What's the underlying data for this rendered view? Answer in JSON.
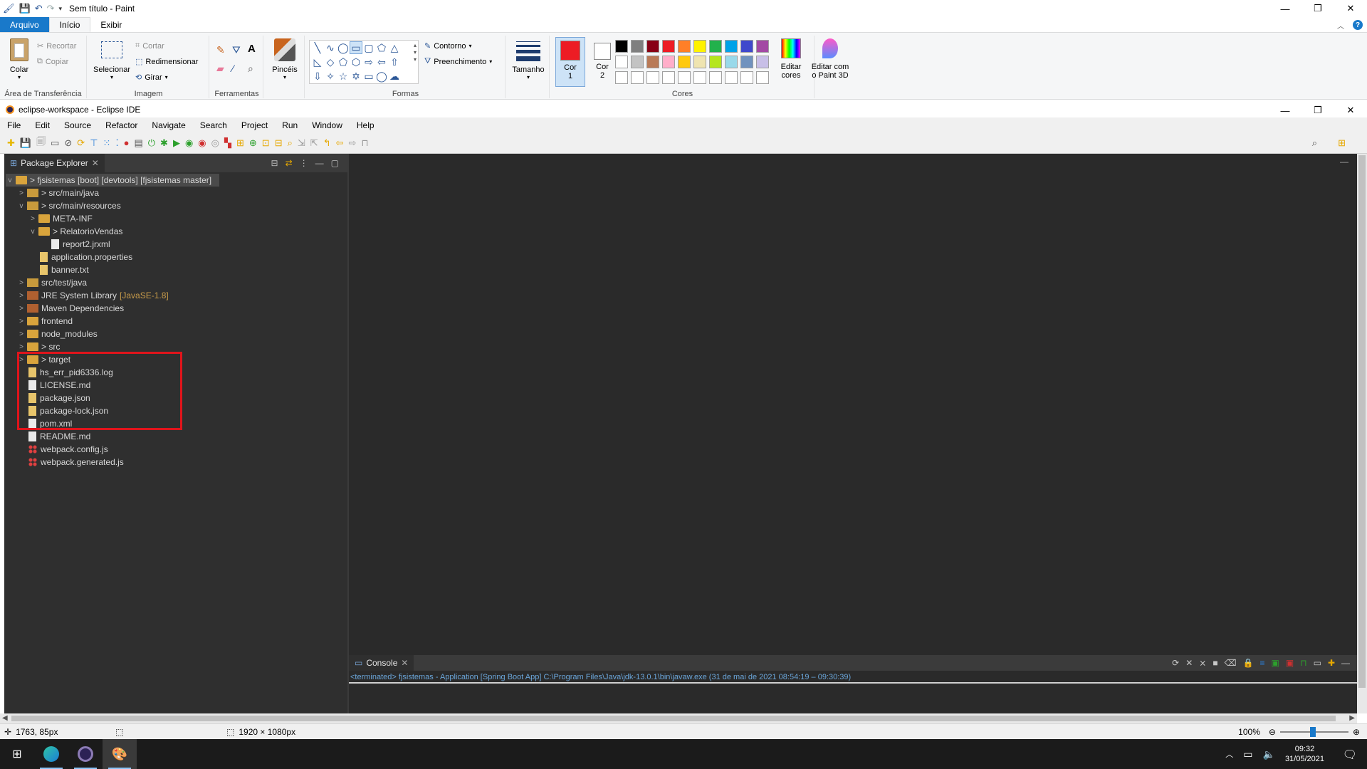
{
  "paint": {
    "title": "Sem título - Paint",
    "tabs": [
      "Arquivo",
      "Início",
      "Exibir"
    ],
    "groups": {
      "clipboard": {
        "label": "Área de Transferência",
        "paste": "Colar",
        "cut": "Recortar",
        "copy": "Copiar"
      },
      "image": {
        "label": "Imagem",
        "select": "Selecionar",
        "crop": "Cortar",
        "resize": "Redimensionar",
        "rotate": "Girar"
      },
      "tools": {
        "label": "Ferramentas"
      },
      "brushes": {
        "label": "Pincéis"
      },
      "shapes": {
        "label": "Formas",
        "outline": "Contorno",
        "fill": "Preenchimento"
      },
      "size": {
        "label": "Tamanho"
      },
      "colors": {
        "label": "Cores",
        "color1": "Cor",
        "color1_num": "1",
        "color2": "Cor",
        "color2_num": "2",
        "color1_value": "#ed1c24",
        "color2_value": "#ffffff",
        "edit": "Editar",
        "edit2": "cores",
        "palette_row1": [
          "#000000",
          "#7f7f7f",
          "#880015",
          "#ed1c24",
          "#ff7f27",
          "#fff200",
          "#22b14c",
          "#00a2e8",
          "#3f48cc",
          "#a349a4"
        ],
        "palette_row2": [
          "#ffffff",
          "#c3c3c3",
          "#b97a57",
          "#ffaec9",
          "#ffc90e",
          "#efe4b0",
          "#b5e61d",
          "#99d9ea",
          "#7092be",
          "#c8bfe7"
        ]
      },
      "paint3d": {
        "line1": "Editar com",
        "line2": "o Paint 3D"
      }
    },
    "status": {
      "cursor_pos": "1763, 85px",
      "canvas_size": "1920 × 1080px",
      "zoom": "100%"
    }
  },
  "eclipse": {
    "title": "eclipse-workspace - Eclipse IDE",
    "menu": [
      "File",
      "Edit",
      "Source",
      "Refactor",
      "Navigate",
      "Search",
      "Project",
      "Run",
      "Window",
      "Help"
    ],
    "package_explorer": {
      "tab": "Package Explorer",
      "project": "> fjsistemas [boot] [devtools] [fjsistemas master]",
      "items": [
        {
          "label": "> src/main/java",
          "indent": 1,
          "twisty": ">",
          "icon": "pkgfolder"
        },
        {
          "label": "> src/main/resources",
          "indent": 1,
          "twisty": "v",
          "icon": "pkgfolder"
        },
        {
          "label": "META-INF",
          "indent": 2,
          "twisty": ">",
          "icon": "folder"
        },
        {
          "label": "> RelatorioVendas",
          "indent": 2,
          "twisty": "v",
          "icon": "folder"
        },
        {
          "label": "report2.jrxml",
          "indent": 3,
          "twisty": "",
          "icon": "file-w"
        },
        {
          "label": "application.properties",
          "indent": 2,
          "twisty": "",
          "icon": "file-y"
        },
        {
          "label": "banner.txt",
          "indent": 2,
          "twisty": "",
          "icon": "file-y"
        },
        {
          "label": "src/test/java",
          "indent": 1,
          "twisty": ">",
          "icon": "pkgfolder"
        },
        {
          "label": "JRE System Library",
          "suffix": "[JavaSE-1.8]",
          "indent": 1,
          "twisty": ">",
          "icon": "jar"
        },
        {
          "label": "Maven Dependencies",
          "indent": 1,
          "twisty": ">",
          "icon": "jar"
        },
        {
          "label": "frontend",
          "indent": 1,
          "twisty": ">",
          "icon": "folder"
        },
        {
          "label": "node_modules",
          "indent": 1,
          "twisty": ">",
          "icon": "folder"
        },
        {
          "label": "> src",
          "indent": 1,
          "twisty": ">",
          "icon": "folder"
        },
        {
          "label": "> target",
          "indent": 1,
          "twisty": ">",
          "icon": "folder"
        },
        {
          "label": "hs_err_pid6336.log",
          "indent": 1,
          "twisty": "",
          "icon": "file-y"
        },
        {
          "label": "LICENSE.md",
          "indent": 1,
          "twisty": "",
          "icon": "file-w"
        },
        {
          "label": "package.json",
          "indent": 1,
          "twisty": "",
          "icon": "file-y"
        },
        {
          "label": "package-lock.json",
          "indent": 1,
          "twisty": "",
          "icon": "file-y"
        },
        {
          "label": "pom.xml",
          "indent": 1,
          "twisty": "",
          "icon": "file-w"
        },
        {
          "label": "README.md",
          "indent": 1,
          "twisty": "",
          "icon": "file-w"
        },
        {
          "label": "webpack.config.js",
          "indent": 1,
          "twisty": "",
          "icon": "file-js"
        },
        {
          "label": "webpack.generated.js",
          "indent": 1,
          "twisty": "",
          "icon": "file-js"
        }
      ]
    },
    "console": {
      "tab": "Console",
      "line": "<terminated> fjsistemas - Application [Spring Boot App] C:\\Program Files\\Java\\jdk-13.0.1\\bin\\javaw.exe  (31 de mai de 2021 08:54:19 – 09:30:39)"
    }
  },
  "taskbar": {
    "time": "09:32",
    "date": "31/05/2021"
  },
  "colors": {
    "highlight": "#e0141b",
    "file_tab": "#1979ca",
    "dark_bg": "#2a2a2a"
  }
}
